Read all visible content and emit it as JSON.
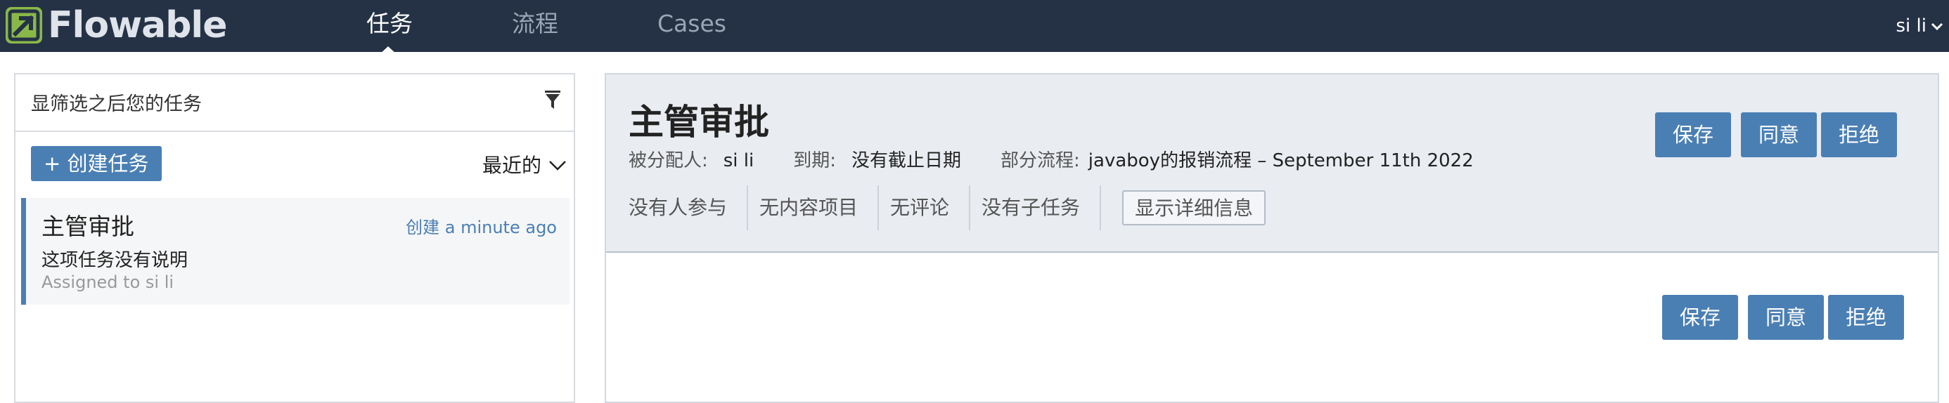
{
  "app": {
    "logo_text": "Flowable"
  },
  "nav": {
    "tabs": [
      {
        "label": "任务",
        "active": true
      },
      {
        "label": "流程",
        "active": false
      },
      {
        "label": "Cases",
        "active": false
      }
    ],
    "user": "si li"
  },
  "task_list": {
    "filter_text": "显筛选之后您的任务",
    "create_button": "+ 创建任务",
    "sort_label": "最近的",
    "items": [
      {
        "title": "主管审批",
        "created": "创建 a minute ago",
        "description": "这项任务没有说明",
        "assignee": "Assigned to si li"
      }
    ]
  },
  "task_detail": {
    "title": "主管审批",
    "meta": {
      "assignee_label": "被分配人:",
      "assignee_value": "si li",
      "due_label": "到期:",
      "due_value": "没有截止日期",
      "process_label": "部分流程:",
      "process_value": "javaboy的报销流程 – September 11th 2022"
    },
    "stats": [
      "没有人参与",
      "无内容项目",
      "无评论",
      "没有子任务"
    ],
    "show_details": "显示详细信息",
    "header_actions": {
      "save": "保存",
      "approve": "同意",
      "reject": "拒绝"
    },
    "form_actions": {
      "save": "保存",
      "approve": "同意",
      "reject": "拒绝"
    }
  },
  "colors": {
    "navbar": "#253246",
    "brand_green": "#8ab848",
    "accent_blue": "#4a7fb4",
    "header_bg": "#e9ecf1"
  }
}
